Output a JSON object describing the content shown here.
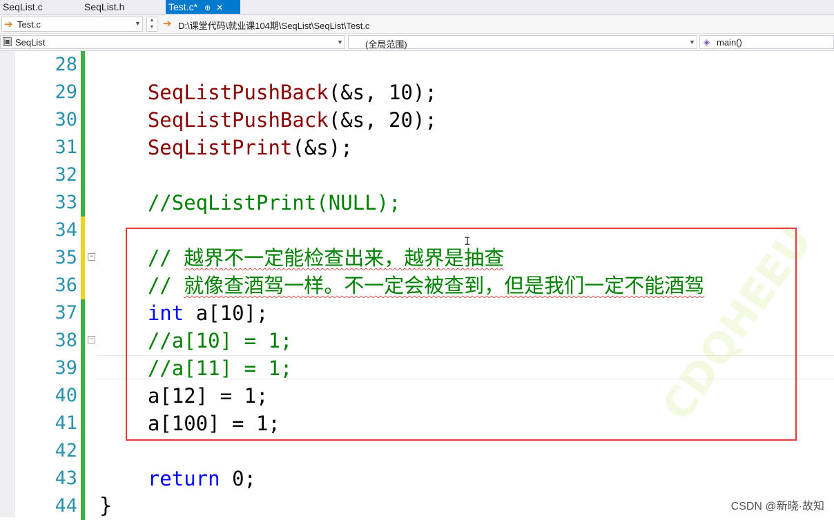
{
  "tabs": [
    {
      "label": "SeqList.c",
      "active": false
    },
    {
      "label": "SeqList.h",
      "active": false
    },
    {
      "label": "Test.c*",
      "active": true
    }
  ],
  "path_bar": {
    "file": "Test.c",
    "path": "D:\\课堂代码\\就业课104期\\SeqList\\SeqList\\Test.c"
  },
  "nav_bar": {
    "project": "SeqList",
    "scope": "(全局范围)",
    "member": "main()"
  },
  "colors": {
    "accent": "#007acc",
    "line_number": "#2b91af",
    "function": "#880000",
    "keyword": "#0000ff",
    "comment": "#008000",
    "saved_change": "#3cb043",
    "unsaved_change": "#f2d31a",
    "highlight_box": "#e53935"
  },
  "lines": [
    {
      "n": "28",
      "change": "saved",
      "tokens": []
    },
    {
      "n": "29",
      "change": "saved",
      "tokens": [
        {
          "t": "    "
        },
        {
          "t": "SeqListPushBack",
          "c": "fn"
        },
        {
          "t": "(&s, 10);"
        }
      ]
    },
    {
      "n": "30",
      "change": "saved",
      "tokens": [
        {
          "t": "    "
        },
        {
          "t": "SeqListPushBack",
          "c": "fn"
        },
        {
          "t": "(&s, 20);"
        }
      ]
    },
    {
      "n": "31",
      "change": "saved",
      "tokens": [
        {
          "t": "    "
        },
        {
          "t": "SeqListPrint",
          "c": "fn"
        },
        {
          "t": "(&s);"
        }
      ]
    },
    {
      "n": "32",
      "change": "saved",
      "tokens": []
    },
    {
      "n": "33",
      "change": "saved",
      "tokens": [
        {
          "t": "    "
        },
        {
          "t": "//SeqListPrint(NULL);",
          "c": "cm"
        }
      ]
    },
    {
      "n": "34",
      "change": "unsaved",
      "tokens": []
    },
    {
      "n": "35",
      "change": "unsaved",
      "fold": "−",
      "tokens": [
        {
          "t": "    "
        },
        {
          "t": "// ",
          "c": "cm"
        },
        {
          "t": "越界不一定能检查出来，越界是抽查",
          "c": "cm cm-cn"
        }
      ]
    },
    {
      "n": "36",
      "change": "unsaved",
      "tokens": [
        {
          "t": "    "
        },
        {
          "t": "// ",
          "c": "cm"
        },
        {
          "t": "就像查酒驾一样。不一定会被查到，但是我们一定不能酒驾",
          "c": "cm cm-cn"
        }
      ]
    },
    {
      "n": "37",
      "change": "saved",
      "tokens": [
        {
          "t": "    "
        },
        {
          "t": "int",
          "c": "kw"
        },
        {
          "t": " a[10];"
        }
      ]
    },
    {
      "n": "38",
      "change": "saved",
      "fold": "−",
      "tokens": [
        {
          "t": "    "
        },
        {
          "t": "//a[10] = 1;",
          "c": "cm"
        }
      ]
    },
    {
      "n": "39",
      "change": "saved",
      "tokens": [
        {
          "t": "    "
        },
        {
          "t": "//a[11] = 1;",
          "c": "cm"
        }
      ]
    },
    {
      "n": "40",
      "change": "saved",
      "tokens": [
        {
          "t": "    a[12] = 1;"
        }
      ]
    },
    {
      "n": "41",
      "change": "saved",
      "tokens": [
        {
          "t": "    a[100] = 1;"
        }
      ]
    },
    {
      "n": "42",
      "change": "saved",
      "tokens": []
    },
    {
      "n": "43",
      "change": "saved",
      "tokens": [
        {
          "t": "    "
        },
        {
          "t": "return",
          "c": "kw"
        },
        {
          "t": " 0;"
        }
      ]
    },
    {
      "n": "44",
      "change": "saved",
      "tokens": [],
      "brace": "}"
    }
  ],
  "watermark": "CDQHEEU",
  "credit": "CSDN @新晓·故知"
}
